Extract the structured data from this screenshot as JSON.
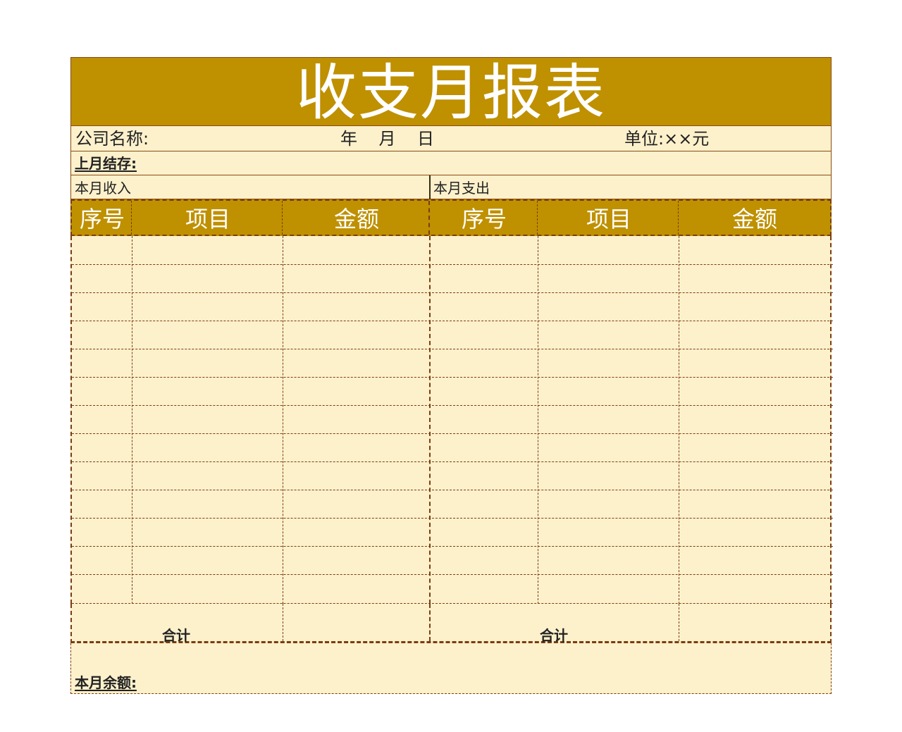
{
  "title": "收支月报表",
  "info": {
    "company_label": "公司名称:",
    "date_label": "年    月    日",
    "unit_label": "单位:××元",
    "carry_over_label": "上月结存:",
    "income_label": "本月收入",
    "expense_label": "本月支出"
  },
  "table": {
    "headers": [
      "序号",
      "项目",
      "金额",
      "序号",
      "项目",
      "金额"
    ],
    "empty_rows": 13,
    "total_label_left": "合计",
    "total_label_right": "合计"
  },
  "balance_label": "本月余额:",
  "colors": {
    "header_gold": "#bf9000",
    "sheet_bg": "#fdf1cc",
    "border_brown": "#7a3d10"
  }
}
